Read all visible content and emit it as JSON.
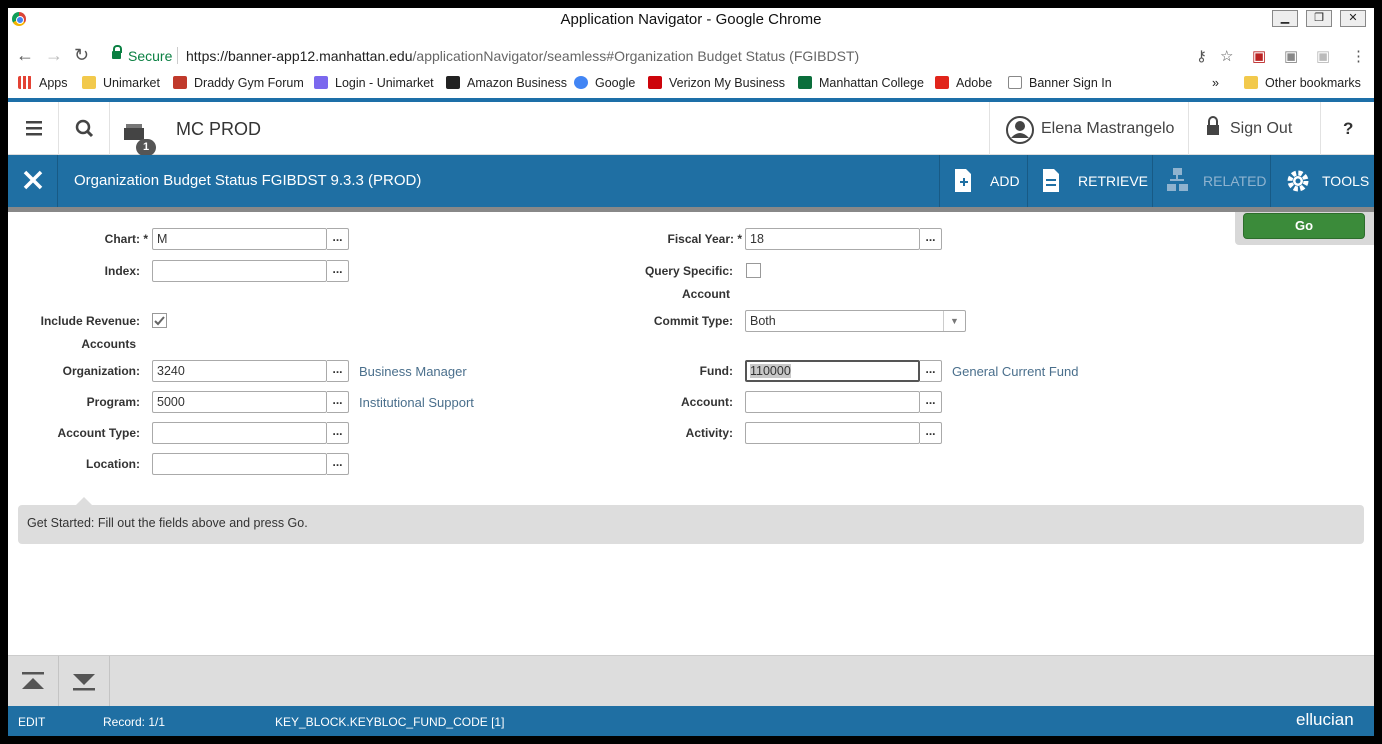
{
  "window": {
    "title": "Application Navigator - Google Chrome"
  },
  "browser": {
    "secure_label": "Secure",
    "url_host": "https://banner-app12.manhattan.edu",
    "url_path": "/applicationNavigator/seamless#Organization Budget Status (FGIBDST)",
    "bookmarks": [
      {
        "label": "Apps",
        "color": "#e34234"
      },
      {
        "label": "Unimarket",
        "color": "#f2c94c"
      },
      {
        "label": "Draddy Gym Forum",
        "color": "#c0392b"
      },
      {
        "label": "Login - Unimarket",
        "color": "#7b68ee"
      },
      {
        "label": "Amazon Business",
        "color": "#222222"
      },
      {
        "label": "Google",
        "color": "#4285f4"
      },
      {
        "label": "Verizon My Business",
        "color": "#cd040b"
      },
      {
        "label": "Manhattan College",
        "color": "#0b6e3b"
      },
      {
        "label": "Adobe",
        "color": "#e1251b"
      },
      {
        "label": "Banner Sign In",
        "color": "#888888"
      }
    ],
    "other_bookmarks": "Other bookmarks",
    "more_chevron": "»"
  },
  "header": {
    "app_name": "MC PROD",
    "recent_count": "1",
    "user_name": "Elena Mastrangelo",
    "sign_out": "Sign Out",
    "help": "?"
  },
  "page": {
    "title": "Organization Budget Status FGIBDST 9.3.3 (PROD)",
    "actions": {
      "add": "ADD",
      "retrieve": "RETRIEVE",
      "related": "RELATED",
      "tools": "TOOLS"
    },
    "go_label": "Go"
  },
  "form": {
    "chart_label": "Chart: *",
    "chart_value": "M",
    "index_label": "Index:",
    "index_value": "",
    "include_revenue_label": "Include Revenue:",
    "include_revenue_label2": "Accounts",
    "include_revenue_checked": true,
    "organization_label": "Organization:",
    "organization_value": "3240",
    "organization_desc": "Business Manager",
    "program_label": "Program:",
    "program_value": "5000",
    "program_desc": "Institutional Support",
    "account_type_label": "Account Type:",
    "account_type_value": "",
    "location_label": "Location:",
    "location_value": "",
    "fiscal_year_label": "Fiscal Year: *",
    "fiscal_year_value": "18",
    "query_specific_label": "Query Specific:",
    "query_specific_label2": "Account",
    "query_specific_checked": false,
    "commit_type_label": "Commit Type:",
    "commit_type_value": "Both",
    "fund_label": "Fund:",
    "fund_value": "110000",
    "fund_desc": "General Current Fund",
    "account_label": "Account:",
    "account_value": "",
    "activity_label": "Activity:",
    "activity_value": "",
    "lov_label": "..."
  },
  "message": "Get Started: Fill out the fields above and press Go.",
  "status": {
    "mode": "EDIT",
    "record": "Record: 1/1",
    "field": "KEY_BLOCK.KEYBLOC_FUND_CODE [1]",
    "brand": "ellucian"
  },
  "colors": {
    "accent": "#1f6fa3",
    "go": "#3b8b3a"
  }
}
